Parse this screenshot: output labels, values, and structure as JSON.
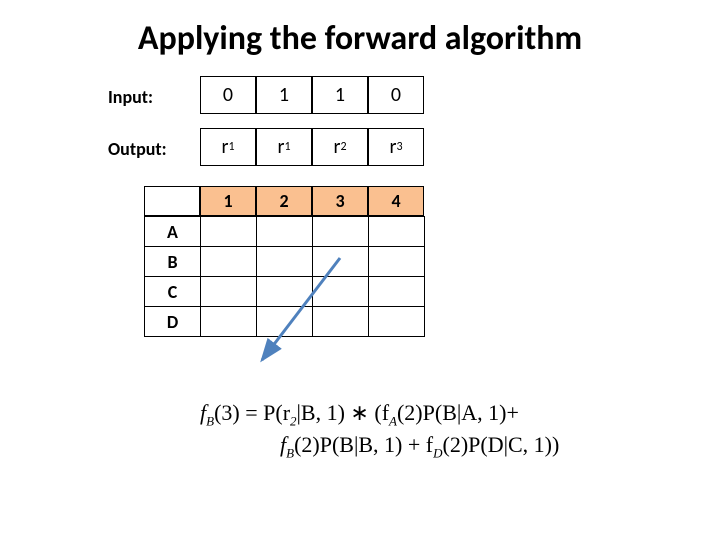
{
  "title": "Applying the forward algorithm",
  "labels": {
    "input": "Input:",
    "output": "Output:"
  },
  "input": [
    "0",
    "1",
    "1",
    "0"
  ],
  "output": [
    {
      "sym": "r",
      "sub": "1"
    },
    {
      "sym": "r",
      "sub": "1"
    },
    {
      "sym": "r",
      "sub": "2"
    },
    {
      "sym": "r",
      "sub": "3"
    }
  ],
  "cols": [
    "1",
    "2",
    "3",
    "4"
  ],
  "rows": [
    "A",
    "B",
    "C",
    "D"
  ],
  "table": [
    [
      "",
      "",
      "",
      ""
    ],
    [
      "",
      "",
      "",
      ""
    ],
    [
      "",
      "",
      "",
      ""
    ],
    [
      "",
      "",
      "",
      ""
    ]
  ],
  "formula": {
    "line1": {
      "pre": "f",
      "sub1": "B",
      "mid1": "(3) = P(r",
      "sub2": "2",
      "mid2": "|B, 1) ∗ (f",
      "sub3": "A",
      "mid3": "(2)P(B|A, 1)+"
    },
    "line2": {
      "pre": "f",
      "sub1": "B",
      "mid1": "(2)P(B|B, 1) + f",
      "sub2": "D",
      "mid2": "(2)P(D|C, 1))"
    }
  }
}
